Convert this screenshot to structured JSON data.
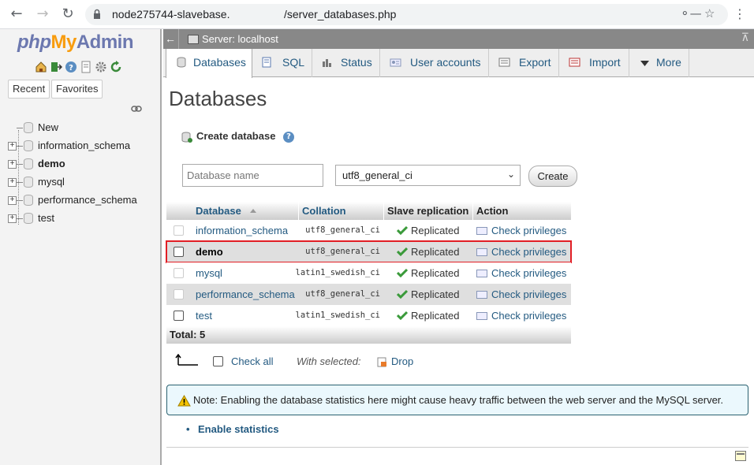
{
  "browser": {
    "url_host": "node275744-slavebase.",
    "url_path": "/server_databases.php"
  },
  "nav": {
    "logo_php": "php",
    "logo_my": "My",
    "logo_admin": "Admin",
    "recent_label": "Recent",
    "favorites_label": "Favorites",
    "tree": [
      {
        "label": "New"
      },
      {
        "label": "information_schema"
      },
      {
        "label": "demo"
      },
      {
        "label": "mysql"
      },
      {
        "label": "performance_schema"
      },
      {
        "label": "test"
      }
    ]
  },
  "server": {
    "breadcrumb": "Server: localhost"
  },
  "tabs": [
    {
      "label": "Databases"
    },
    {
      "label": "SQL"
    },
    {
      "label": "Status"
    },
    {
      "label": "User accounts"
    },
    {
      "label": "Export"
    },
    {
      "label": "Import"
    },
    {
      "label": "More"
    }
  ],
  "main": {
    "title": "Databases",
    "create_db_label": "Create database",
    "dbname_placeholder": "Database name",
    "collation_selected": "utf8_general_ci",
    "create_button": "Create"
  },
  "table": {
    "headers": {
      "database": "Database",
      "collation": "Collation",
      "replication": "Slave replication",
      "action": "Action"
    },
    "rows": [
      {
        "name": "information_schema",
        "collation": "utf8_general_ci",
        "replication": "Replicated",
        "action": "Check privileges"
      },
      {
        "name": "demo",
        "collation": "utf8_general_ci",
        "replication": "Replicated",
        "action": "Check privileges"
      },
      {
        "name": "mysql",
        "collation": "latin1_swedish_ci",
        "replication": "Replicated",
        "action": "Check privileges"
      },
      {
        "name": "performance_schema",
        "collation": "utf8_general_ci",
        "replication": "Replicated",
        "action": "Check privileges"
      },
      {
        "name": "test",
        "collation": "latin1_swedish_ci",
        "replication": "Replicated",
        "action": "Check privileges"
      }
    ],
    "total": "Total: 5"
  },
  "bulk": {
    "check_all": "Check all",
    "with_selected": "With selected:",
    "drop": "Drop"
  },
  "notice": {
    "text": "Note: Enabling the database statistics here might cause heavy traffic between the web server and the MySQL server."
  },
  "enable_statistics": "Enable statistics",
  "colors": {
    "link": "#235a81",
    "highlight_border": "#e21e25",
    "server_bar": "#888888",
    "notice_bg": "#ebf8fd"
  }
}
